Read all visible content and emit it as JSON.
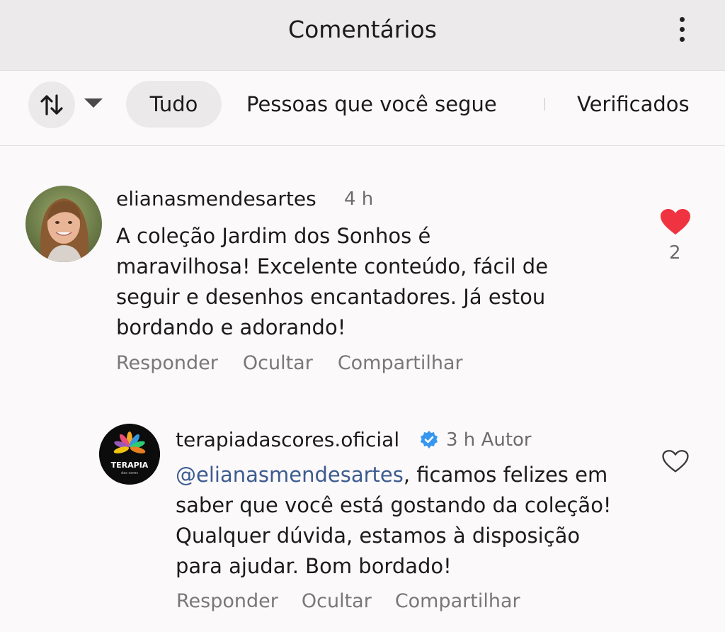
{
  "header": {
    "title": "Comentários",
    "menu_icon": "more-vert-icon"
  },
  "filters": {
    "sort_icon": "sort-arrows-icon",
    "dropdown_icon": "caret-down-icon",
    "chips": [
      "Tudo",
      "Pessoas que você segue",
      "Verificados"
    ],
    "selected": "Tudo"
  },
  "comments": [
    {
      "username": "elianasmendesartes",
      "time": "4 h",
      "lines": [
        "A coleção Jardim dos Sonhos é",
        "maravilhosa! Excelente conteúdo, fácil de",
        "seguir e desenhos encantadores. Já estou",
        "bordando e adorando!"
      ],
      "liked": true,
      "like_count": "2",
      "actions": [
        "Responder",
        "Ocultar",
        "Compartilhar"
      ]
    },
    {
      "username": "terapiadascores.oficial",
      "verified": true,
      "time": "3 h",
      "author_tag": "Autor",
      "mention": "@elianasmendesartes",
      "first_line_rest": ", ficamos felizes em",
      "lines": [
        "saber que você está gostando da coleção!",
        "Qualquer dúvida, estamos à disposição",
        "para ajudar. Bom bordado!"
      ],
      "liked": false,
      "actions": [
        "Responder",
        "Ocultar",
        "Compartilhar"
      ],
      "avatar_logo_text": "TERAPIA",
      "avatar_logo_subtext": "das cores"
    }
  ],
  "colors": {
    "like_red": "#ef3340",
    "verified_blue": "#3797f0",
    "mention_blue": "#3d5b8f"
  }
}
